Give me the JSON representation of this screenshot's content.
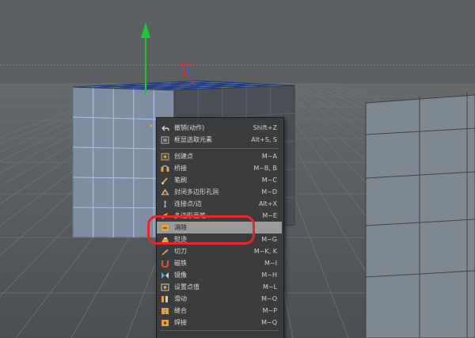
{
  "menu": {
    "items": [
      {
        "label": "撤销(动作)",
        "shortcut": "Shift+Z",
        "icon": "undo-icon",
        "color": "#cfcfcf"
      },
      {
        "label": "框显选取元素",
        "shortcut": "Alt+S, S",
        "icon": "frame-selection-icon",
        "color": "#b9b9b9"
      },
      {
        "label": "创建点",
        "shortcut": "M~A",
        "icon": "create-point-icon",
        "color": "#e3a33b"
      },
      {
        "label": "桥接",
        "shortcut": "M~B, B",
        "icon": "bridge-icon",
        "color": "#e3a33b"
      },
      {
        "label": "笔刷",
        "shortcut": "M~C",
        "icon": "brush-icon",
        "color": "#e3a33b"
      },
      {
        "label": "封闭多边形孔洞",
        "shortcut": "M~D",
        "icon": "close-polygon-hole-icon",
        "color": "#d88a3a"
      },
      {
        "label": "连接点/边",
        "shortcut": "Alt+X",
        "icon": "connect-points-edges-icon",
        "color": "#bbbbbb"
      },
      {
        "label": "多边形画笔",
        "shortcut": "M~E",
        "icon": "polygon-pen-icon",
        "color": "#e3a33b"
      },
      {
        "label": "消除",
        "shortcut": "",
        "icon": "dissolve-icon",
        "color": "#e3a33b"
      },
      {
        "label": "熨烫",
        "shortcut": "M~G",
        "icon": "iron-icon",
        "color": "#e3a33b"
      },
      {
        "label": "切刀",
        "shortcut": "M~K, K",
        "icon": "knife-icon",
        "color": "#e3a33b"
      },
      {
        "label": "磁铁",
        "shortcut": "M~I",
        "icon": "magnet-icon",
        "color": "#e34b3b"
      },
      {
        "label": "镜像",
        "shortcut": "M~H",
        "icon": "mirror-icon",
        "color": "#6fa0d8"
      },
      {
        "label": "设置点值",
        "shortcut": "M~L",
        "icon": "set-point-value-icon",
        "color": "#e3a33b"
      },
      {
        "label": "滑动",
        "shortcut": "M~O",
        "icon": "slide-icon",
        "color": "#e3a33b"
      },
      {
        "label": "缝合",
        "shortcut": "M~P",
        "icon": "stitch-icon",
        "color": "#e3a33b"
      },
      {
        "label": "焊接",
        "shortcut": "M~Q",
        "icon": "weld-icon",
        "color": "#e3a33b"
      }
    ],
    "highlighted_index": 8
  },
  "colors": {
    "highlight_ring": "#e8262a",
    "menu_bg": "#3a3c3e",
    "axis_y": "#1ec832",
    "axis_x": "#d82c2c",
    "axis_z": "#2c62d8"
  }
}
